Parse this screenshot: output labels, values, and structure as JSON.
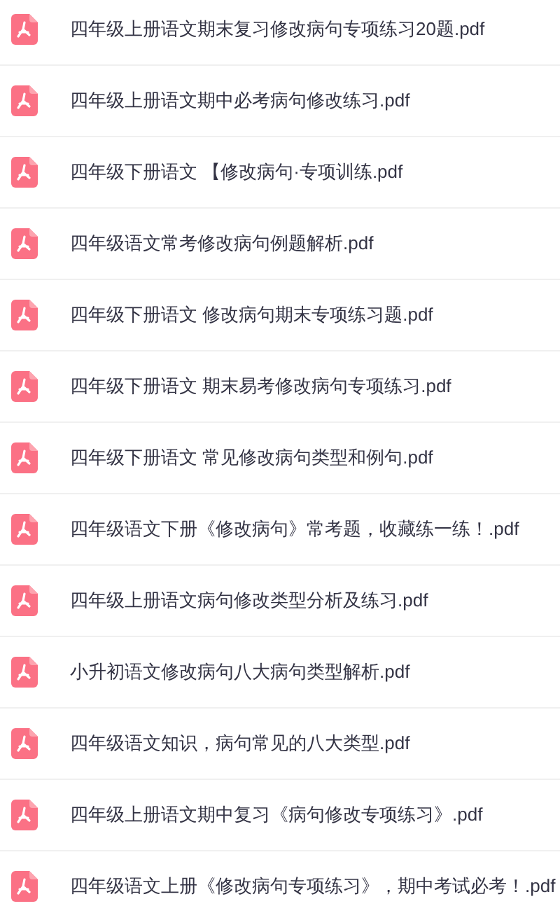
{
  "files": [
    {
      "name": "四年级上册语文期末复习修改病句专项练习20题.pdf"
    },
    {
      "name": "四年级上册语文期中必考病句修改练习.pdf"
    },
    {
      "name": "四年级下册语文 【修改病句·专项训练.pdf"
    },
    {
      "name": "四年级语文常考修改病句例题解析.pdf"
    },
    {
      "name": "四年级下册语文 修改病句期末专项练习题.pdf"
    },
    {
      "name": "四年级下册语文 期末易考修改病句专项练习.pdf"
    },
    {
      "name": "四年级下册语文 常见修改病句类型和例句.pdf"
    },
    {
      "name": "四年级语文下册《修改病句》常考题，收藏练一练！.pdf"
    },
    {
      "name": "四年级上册语文病句修改类型分析及练习.pdf"
    },
    {
      "name": "小升初语文修改病句八大病句类型解析.pdf"
    },
    {
      "name": "四年级语文知识，病句常见的八大类型.pdf"
    },
    {
      "name": "四年级上册语文期中复习《病句修改专项练习》.pdf"
    },
    {
      "name": "四年级语文上册《修改病句专项练习》，期中考试必考！.pdf"
    }
  ]
}
